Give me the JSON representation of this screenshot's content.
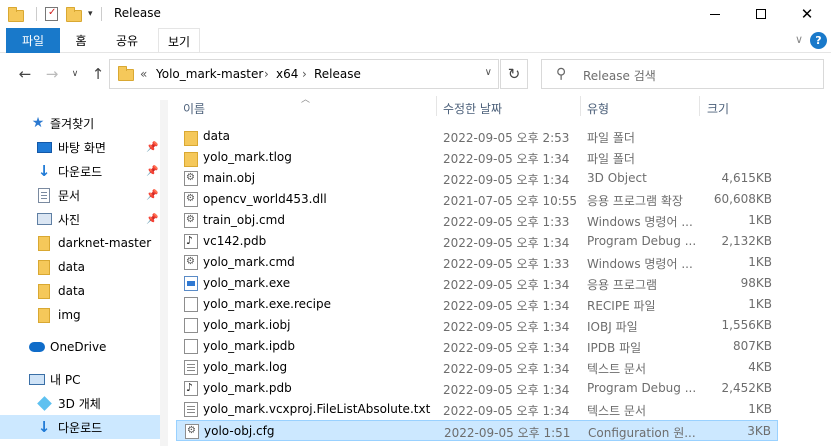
{
  "window": {
    "title": "Release",
    "minimize_icon": "minimize-icon",
    "maximize_icon": "maximize-icon",
    "close_icon": "close-icon"
  },
  "ribbon": {
    "tabs": [
      "파일",
      "홈",
      "공유",
      "보기"
    ],
    "help": "?",
    "expand": "∨"
  },
  "address": {
    "overflow": "«",
    "crumbs": [
      "Yolo_mark-master",
      "x64",
      "Release"
    ],
    "sep": "›"
  },
  "search": {
    "placeholder": "Release 검색"
  },
  "sidebar": {
    "items": [
      {
        "label": "즐겨찾기",
        "icon": "star-icon"
      },
      {
        "label": "바탕 화면",
        "icon": "desktop-icon",
        "pinned": true
      },
      {
        "label": "다운로드",
        "icon": "download-icon",
        "pinned": true
      },
      {
        "label": "문서",
        "icon": "document-icon",
        "pinned": true
      },
      {
        "label": "사진",
        "icon": "pictures-icon",
        "pinned": true
      },
      {
        "label": "darknet-master",
        "icon": "folder-icon"
      },
      {
        "label": "data",
        "icon": "folder-icon"
      },
      {
        "label": "data",
        "icon": "folder-icon"
      },
      {
        "label": "img",
        "icon": "folder-icon"
      },
      {
        "label": "OneDrive",
        "icon": "onedrive-icon"
      },
      {
        "label": "내 PC",
        "icon": "pc-icon"
      },
      {
        "label": "3D 개체",
        "icon": "3d-objects-icon"
      },
      {
        "label": "다운로드",
        "icon": "download-icon",
        "selected": true
      }
    ]
  },
  "columns": {
    "name": "이름",
    "date": "수정한 날짜",
    "type": "유형",
    "size": "크기"
  },
  "files": [
    {
      "name": "data",
      "date": "2022-09-05 오후 2:53",
      "type": "파일 폴더",
      "size": "",
      "icon": "folder"
    },
    {
      "name": "yolo_mark.tlog",
      "date": "2022-09-05 오후 1:34",
      "type": "파일 폴더",
      "size": "",
      "icon": "folder"
    },
    {
      "name": "main.obj",
      "date": "2022-09-05 오후 1:34",
      "type": "3D Object",
      "size": "4,615KB",
      "icon": "gear"
    },
    {
      "name": "opencv_world453.dll",
      "date": "2021-07-05 오후 10:55",
      "type": "응용 프로그램 확장",
      "size": "60,608KB",
      "icon": "gear"
    },
    {
      "name": "train_obj.cmd",
      "date": "2022-09-05 오후 1:33",
      "type": "Windows 명령어 ...",
      "size": "1KB",
      "icon": "gear"
    },
    {
      "name": "vc142.pdb",
      "date": "2022-09-05 오후 1:34",
      "type": "Program Debug ...",
      "size": "2,132KB",
      "icon": "pdb"
    },
    {
      "name": "yolo_mark.cmd",
      "date": "2022-09-05 오후 1:33",
      "type": "Windows 명령어 ...",
      "size": "1KB",
      "icon": "gear"
    },
    {
      "name": "yolo_mark.exe",
      "date": "2022-09-05 오후 1:34",
      "type": "응용 프로그램",
      "size": "98KB",
      "icon": "exe"
    },
    {
      "name": "yolo_mark.exe.recipe",
      "date": "2022-09-05 오후 1:34",
      "type": "RECIPE 파일",
      "size": "1KB",
      "icon": "file"
    },
    {
      "name": "yolo_mark.iobj",
      "date": "2022-09-05 오후 1:34",
      "type": "IOBJ 파일",
      "size": "1,556KB",
      "icon": "file"
    },
    {
      "name": "yolo_mark.ipdb",
      "date": "2022-09-05 오후 1:34",
      "type": "IPDB 파일",
      "size": "807KB",
      "icon": "file"
    },
    {
      "name": "yolo_mark.log",
      "date": "2022-09-05 오후 1:34",
      "type": "텍스트 문서",
      "size": "4KB",
      "icon": "text"
    },
    {
      "name": "yolo_mark.pdb",
      "date": "2022-09-05 오후 1:34",
      "type": "Program Debug ...",
      "size": "2,452KB",
      "icon": "pdb"
    },
    {
      "name": "yolo_mark.vcxproj.FileListAbsolute.txt",
      "date": "2022-09-05 오후 1:34",
      "type": "텍스트 문서",
      "size": "1KB",
      "icon": "text"
    },
    {
      "name": "yolo-obj.cfg",
      "date": "2022-09-05 오후 1:51",
      "type": "Configuration 원...",
      "size": "3KB",
      "icon": "gear",
      "selected": true
    }
  ]
}
